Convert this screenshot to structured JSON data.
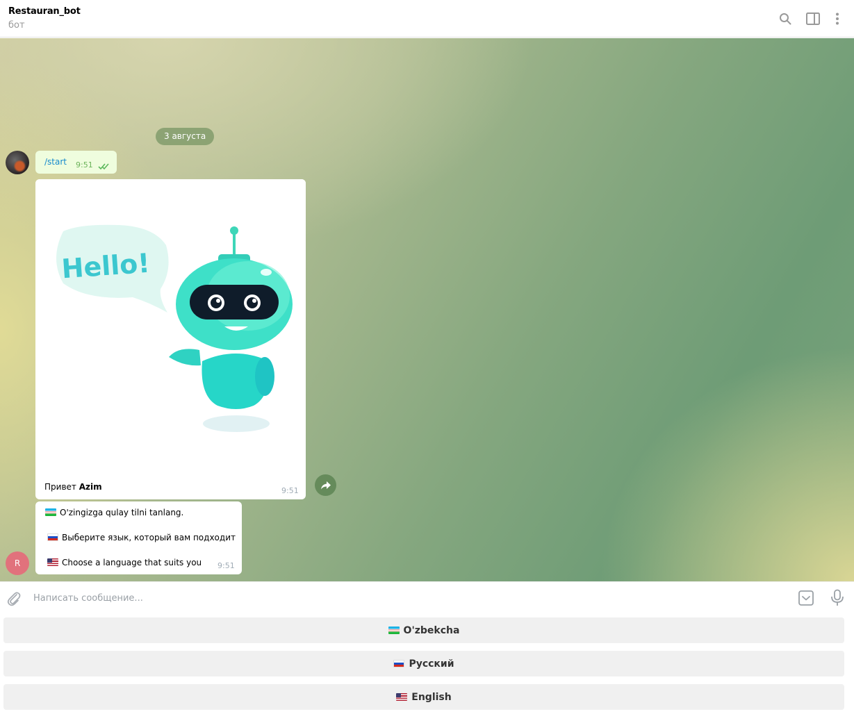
{
  "header": {
    "title": "Restauran_bot",
    "subtitle": "бот",
    "icons": [
      "search-icon",
      "sidebar-toggle-icon",
      "more-vertical-icon"
    ]
  },
  "chat": {
    "date": "3 августа",
    "user_message": {
      "text": "/start",
      "time": "9:51",
      "status": "read"
    },
    "photo_message": {
      "caption_prefix": "Привет",
      "caption_name": "Azim",
      "time": "9:51",
      "image_text": "Hello!"
    },
    "text_message": {
      "lines": [
        "O'zingizga qulay tilni tanlang.",
        "Выберите язык, который вам подходит",
        "Choose a language that suits you"
      ],
      "time": "9:51"
    },
    "bot_avatar_letter": "R"
  },
  "composer": {
    "placeholder": "Написать сообщение..."
  },
  "keyboard": {
    "buttons": [
      "O'zbekcha",
      "Русский",
      "English"
    ]
  },
  "colors": {
    "outgoing_bubble": "#effdde",
    "link": "#168acd",
    "bot_avatar": "#e1727c"
  }
}
